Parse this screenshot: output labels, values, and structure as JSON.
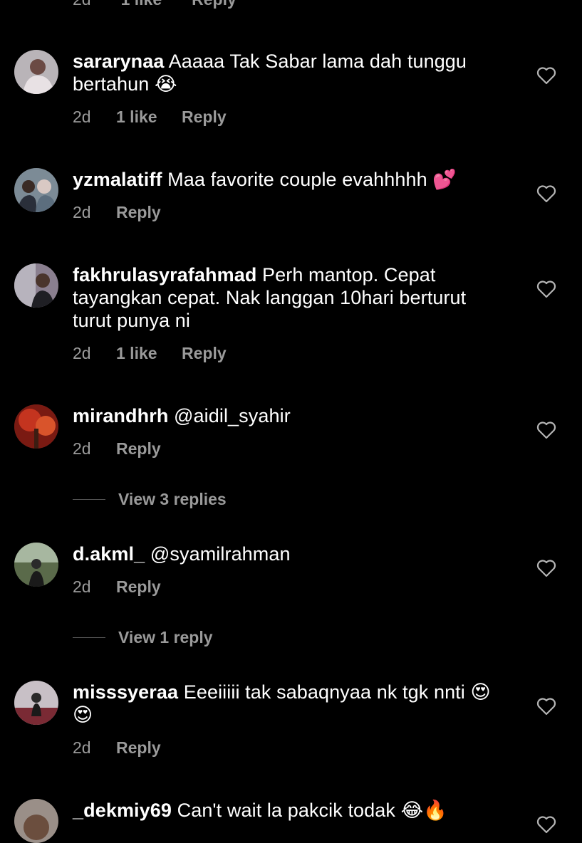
{
  "top_partial": {
    "time": "2d",
    "likes": "1 like",
    "reply": "Reply"
  },
  "comments": [
    {
      "user": "sararynaa",
      "text": " Aaaaa Tak Sabar lama dah tunggu bertahun 😭",
      "time": "2d",
      "likes": "1 like",
      "reply": "Reply"
    },
    {
      "user": "yzmalatiff",
      "text": " Maa favorite couple evahhhhh 💕",
      "time": "2d",
      "likes": "",
      "reply": "Reply"
    },
    {
      "user": "fakhrulasyrafahmad",
      "text": " Perh mantop. Cepat tayangkan cepat. Nak langgan 10hari berturut turut punya ni",
      "time": "2d",
      "likes": "1 like",
      "reply": "Reply"
    },
    {
      "user": "mirandhrh",
      "text": " @aidil_syahir",
      "time": "2d",
      "likes": "",
      "reply": "Reply",
      "view_replies": "View 3 replies"
    },
    {
      "user": "d.akml_",
      "text": " @syamilrahman",
      "time": "2d",
      "likes": "",
      "reply": "Reply",
      "view_replies": "View 1 reply"
    },
    {
      "user": "misssyeraa",
      "text": " Eeeiiiii tak sabaqnyaa nk tgk nnti 😍 😍",
      "time": "2d",
      "likes": "",
      "reply": "Reply"
    },
    {
      "user": "_dekmiy69",
      "text": " Can't wait la pakcik todak 😂🔥",
      "time": "",
      "likes": "",
      "reply": ""
    }
  ],
  "icons": {
    "like": "heart-outline-icon",
    "avatar": "profile-photo"
  }
}
